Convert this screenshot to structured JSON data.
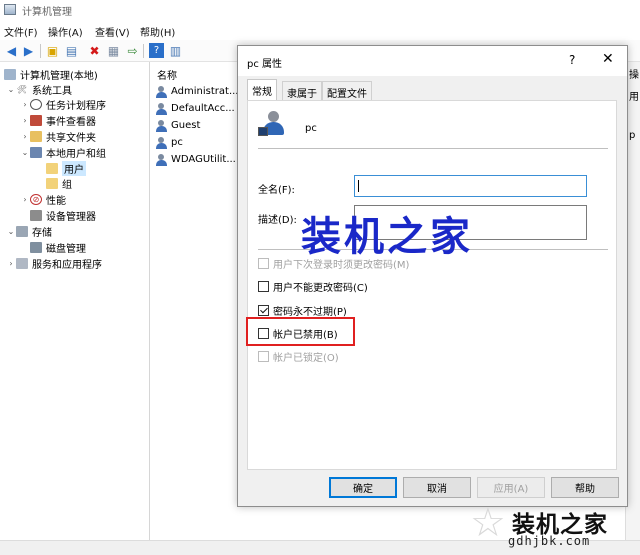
{
  "app": {
    "title": "计算机管理"
  },
  "menu": [
    "文件(F)",
    "操作(A)",
    "查看(V)",
    "帮助(H)"
  ],
  "tree": {
    "items": [
      {
        "label": "计算机管理(本地)"
      },
      {
        "label": "系统工具"
      },
      {
        "label": "任务计划程序"
      },
      {
        "label": "事件查看器"
      },
      {
        "label": "共享文件夹"
      },
      {
        "label": "本地用户和组"
      },
      {
        "label": "用户"
      },
      {
        "label": "组"
      },
      {
        "label": "性能"
      },
      {
        "label": "设备管理器"
      },
      {
        "label": "存储"
      },
      {
        "label": "磁盘管理"
      },
      {
        "label": "服务和应用程序"
      }
    ]
  },
  "list": {
    "header": "名称",
    "rows": [
      "Administrat...",
      "DefaultAcc...",
      "Guest",
      "pc",
      "WDAGUtilit..."
    ]
  },
  "strip": {
    "items": [
      "操",
      "用",
      "p"
    ]
  },
  "dialog": {
    "title": "pc 属性",
    "help": "?",
    "close": "✕",
    "tabs": [
      "常规",
      "隶属于",
      "配置文件"
    ],
    "username": "pc",
    "fullname_label": "全名(F):",
    "fullname_value": "",
    "desc_label": "描述(D):",
    "desc_value": "",
    "checkboxes": [
      {
        "label": "用户下次登录时须更改密码(M)",
        "checked": false,
        "enabled": false
      },
      {
        "label": "用户不能更改密码(C)",
        "checked": false,
        "enabled": true
      },
      {
        "label": "密码永不过期(P)",
        "checked": true,
        "enabled": true
      },
      {
        "label": "帐户已禁用(B)",
        "checked": false,
        "enabled": true
      },
      {
        "label": "帐户已锁定(O)",
        "checked": false,
        "enabled": false
      }
    ],
    "buttons": {
      "ok": "确定",
      "cancel": "取消",
      "apply": "应用(A)",
      "help": "帮助"
    }
  },
  "watermark": {
    "main": "装机之家",
    "corner": "装机之家",
    "url": "gdhjbk.com"
  },
  "colors": {
    "highlight_box": "#e02020",
    "watermark": "#1a28c8",
    "selection": "#cce8ff"
  }
}
